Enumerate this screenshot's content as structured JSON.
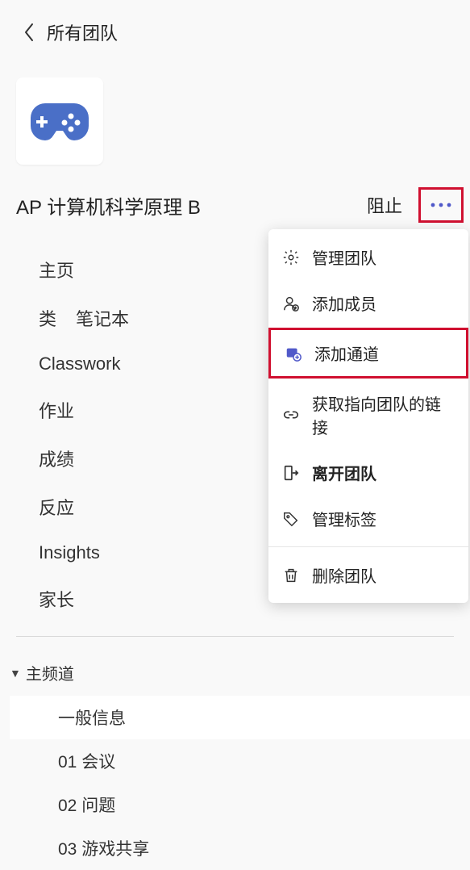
{
  "back": {
    "label": "所有团队"
  },
  "team": {
    "title": "AP 计算机科学原理 B",
    "block_label": "阻止"
  },
  "nav": {
    "home": "主页",
    "class_label": "类",
    "notebook": "笔记本",
    "classwork": "Classwork",
    "assignments": "作业",
    "grades": "成绩",
    "reflect": "反应",
    "insights": "Insights",
    "parents": "家长"
  },
  "channels": {
    "section_label": "主频道",
    "items": [
      "一般信息",
      "01 会议",
      "02 问题",
      "03 游戏共享"
    ]
  },
  "menu": {
    "manage_team": "管理团队",
    "add_member": "添加成员",
    "add_channel": "添加通道",
    "get_link": "获取指向团队的链接",
    "leave_team": "离开团队",
    "manage_tags": "管理标签",
    "delete_team": "删除团队"
  }
}
